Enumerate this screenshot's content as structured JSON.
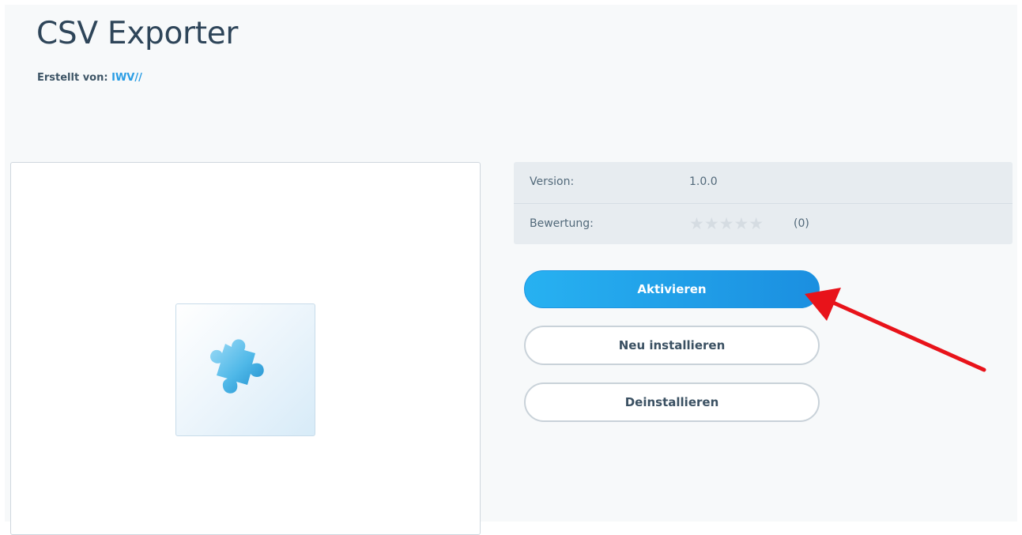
{
  "header": {
    "title": "CSV Exporter",
    "author_label": "Erstellt von:",
    "author_name": "IWV//"
  },
  "image": {
    "icon": "puzzle-piece-icon"
  },
  "details": {
    "version_label": "Version:",
    "version_value": "1.0.0",
    "rating_label": "Bewertung:",
    "rating_stars": "★★★★★",
    "rating_value": 0,
    "rating_count": "(0)"
  },
  "actions": {
    "activate_label": "Aktivieren",
    "reinstall_label": "Neu installieren",
    "uninstall_label": "Deinstallieren"
  },
  "colors": {
    "accent": "#1f9ee8",
    "title": "#2e4559",
    "annotation_arrow": "#e8131a"
  }
}
